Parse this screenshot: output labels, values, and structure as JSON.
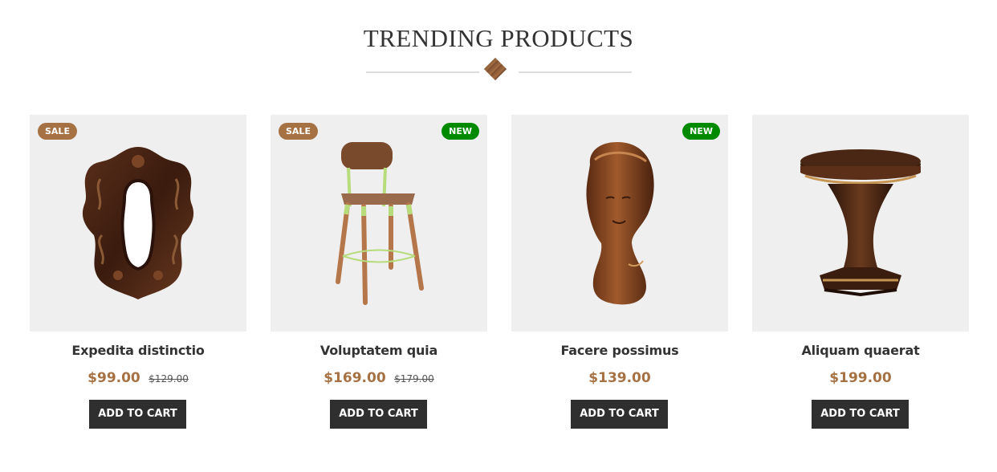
{
  "section": {
    "title": "TRENDING PRODUCTS"
  },
  "colors": {
    "accent": "#a67244",
    "sale_badge": "#a67244",
    "new_badge": "#008a00",
    "button_bg": "#2f2f2f",
    "thumb_bg": "#efefef"
  },
  "products": [
    {
      "name": "Expedita distinctio",
      "price": "$99.00",
      "old_price": "$129.00",
      "sale_badge": "SALE",
      "new_badge": "",
      "button": "ADD TO CART",
      "image": "ornate-mirror-image"
    },
    {
      "name": "Voluptatem quia",
      "price": "$169.00",
      "old_price": "$179.00",
      "sale_badge": "SALE",
      "new_badge": "NEW",
      "button": "ADD TO CART",
      "image": "bar-stool-image"
    },
    {
      "name": "Facere possimus",
      "price": "$139.00",
      "old_price": "",
      "sale_badge": "",
      "new_badge": "NEW",
      "button": "ADD TO CART",
      "image": "wood-bust-sculpture-image"
    },
    {
      "name": "Aliquam quaerat",
      "price": "$199.00",
      "old_price": "",
      "sale_badge": "",
      "new_badge": "",
      "button": "ADD TO CART",
      "image": "pedestal-table-image"
    }
  ]
}
